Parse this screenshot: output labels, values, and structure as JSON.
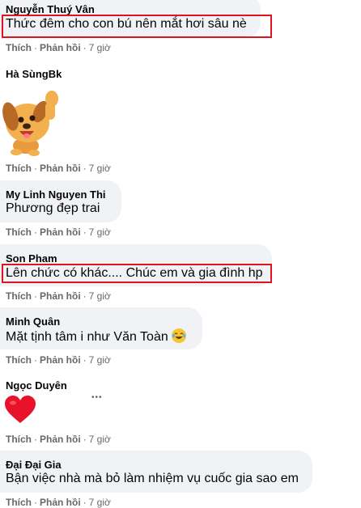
{
  "comments": [
    {
      "author": "Nguyễn Thuý Vân",
      "text": "Thức đêm cho con bú nên mắt hơi sâu nè",
      "time": "7 giờ"
    },
    {
      "author": "Hà SùngBk",
      "sticker": "dog-waving-sticker",
      "time": "7 giờ"
    },
    {
      "author": "My Linh Nguyen Thi",
      "text": "Phương đẹp trai",
      "time": "7 giờ"
    },
    {
      "author": "Son Pham",
      "text": "Lên chức có khác.... Chúc em và gia đình hp",
      "time": "7 giờ"
    },
    {
      "author": "Minh Quân",
      "text": "Mặt tịnh tâm i như Văn Toàn",
      "emoji": "laughing-tears-emoji",
      "time": "7 giờ"
    },
    {
      "author": "Ngọc Duyên",
      "sticker": "red-heart-icon",
      "more": "•••",
      "time": "7 giờ"
    },
    {
      "author": "Đại Đại Gia",
      "text": "Bận việc nhà mà bỏ làm nhiệm vụ cuốc gia sao em",
      "time": "7 giờ"
    }
  ],
  "actions": {
    "like": "Thích",
    "reply": "Phản hồi",
    "dot": "·"
  },
  "colors": {
    "bubble": "#f0f2f5",
    "highlight_box": "#e0141e",
    "meta": "#65676b"
  }
}
